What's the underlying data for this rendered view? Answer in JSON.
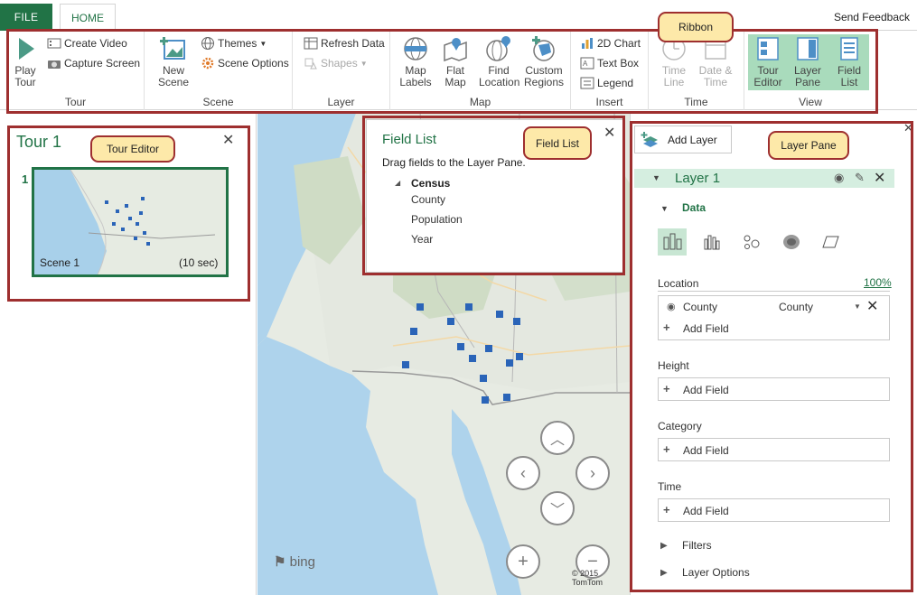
{
  "tabs": {
    "file": "FILE",
    "home": "HOME",
    "send_feedback": "Send Feedback"
  },
  "ribbon": {
    "tour": {
      "label": "Tour",
      "play_tour": "Play Tour",
      "create_video": "Create Video",
      "capture_screen": "Capture Screen"
    },
    "scene": {
      "label": "Scene",
      "new_scene": "New Scene",
      "themes": "Themes",
      "scene_options": "Scene Options"
    },
    "layer": {
      "label": "Layer",
      "refresh_data": "Refresh Data",
      "shapes": "Shapes"
    },
    "map": {
      "label": "Map",
      "map_labels": "Map Labels",
      "flat_map": "Flat Map",
      "find_location": "Find Location",
      "custom_regions": "Custom Regions"
    },
    "insert": {
      "label": "Insert",
      "chart_2d": "2D Chart",
      "text_box": "Text Box",
      "legend": "Legend"
    },
    "time": {
      "label": "Time",
      "time_line": "Time Line",
      "date_time": "Date & Time"
    },
    "view": {
      "label": "View",
      "tour_editor": "Tour Editor",
      "layer_pane": "Layer Pane",
      "field_list": "Field List"
    }
  },
  "callouts": {
    "ribbon": "Ribbon",
    "tour_editor": "Tour Editor",
    "field_list": "Field List",
    "layer_pane": "Layer Pane"
  },
  "tour": {
    "title": "Tour 1",
    "scene_number": "1",
    "scene_name": "Scene 1",
    "scene_duration": "(10 sec)"
  },
  "field_list": {
    "title": "Field List",
    "subtitle": "Drag fields to the Layer Pane.",
    "group": "Census",
    "fields": [
      "County",
      "Population",
      "Year"
    ]
  },
  "map": {
    "bing": "bing",
    "copyright": "© 2015 TomTom"
  },
  "layer_pane": {
    "add_layer": "Add Layer",
    "layer_name": "Layer 1",
    "data_section": "Data",
    "location_label": "Location",
    "location_percent": "100%",
    "location_field": "County",
    "location_type": "County",
    "add_field": "Add Field",
    "height_label": "Height",
    "category_label": "Category",
    "time_label": "Time",
    "filters": "Filters",
    "layer_options": "Layer Options"
  },
  "colors": {
    "accent": "#217346",
    "annotation": "#9e2f2f",
    "callout": "#fde9a9",
    "view_highlight": "#a9dbbc"
  }
}
